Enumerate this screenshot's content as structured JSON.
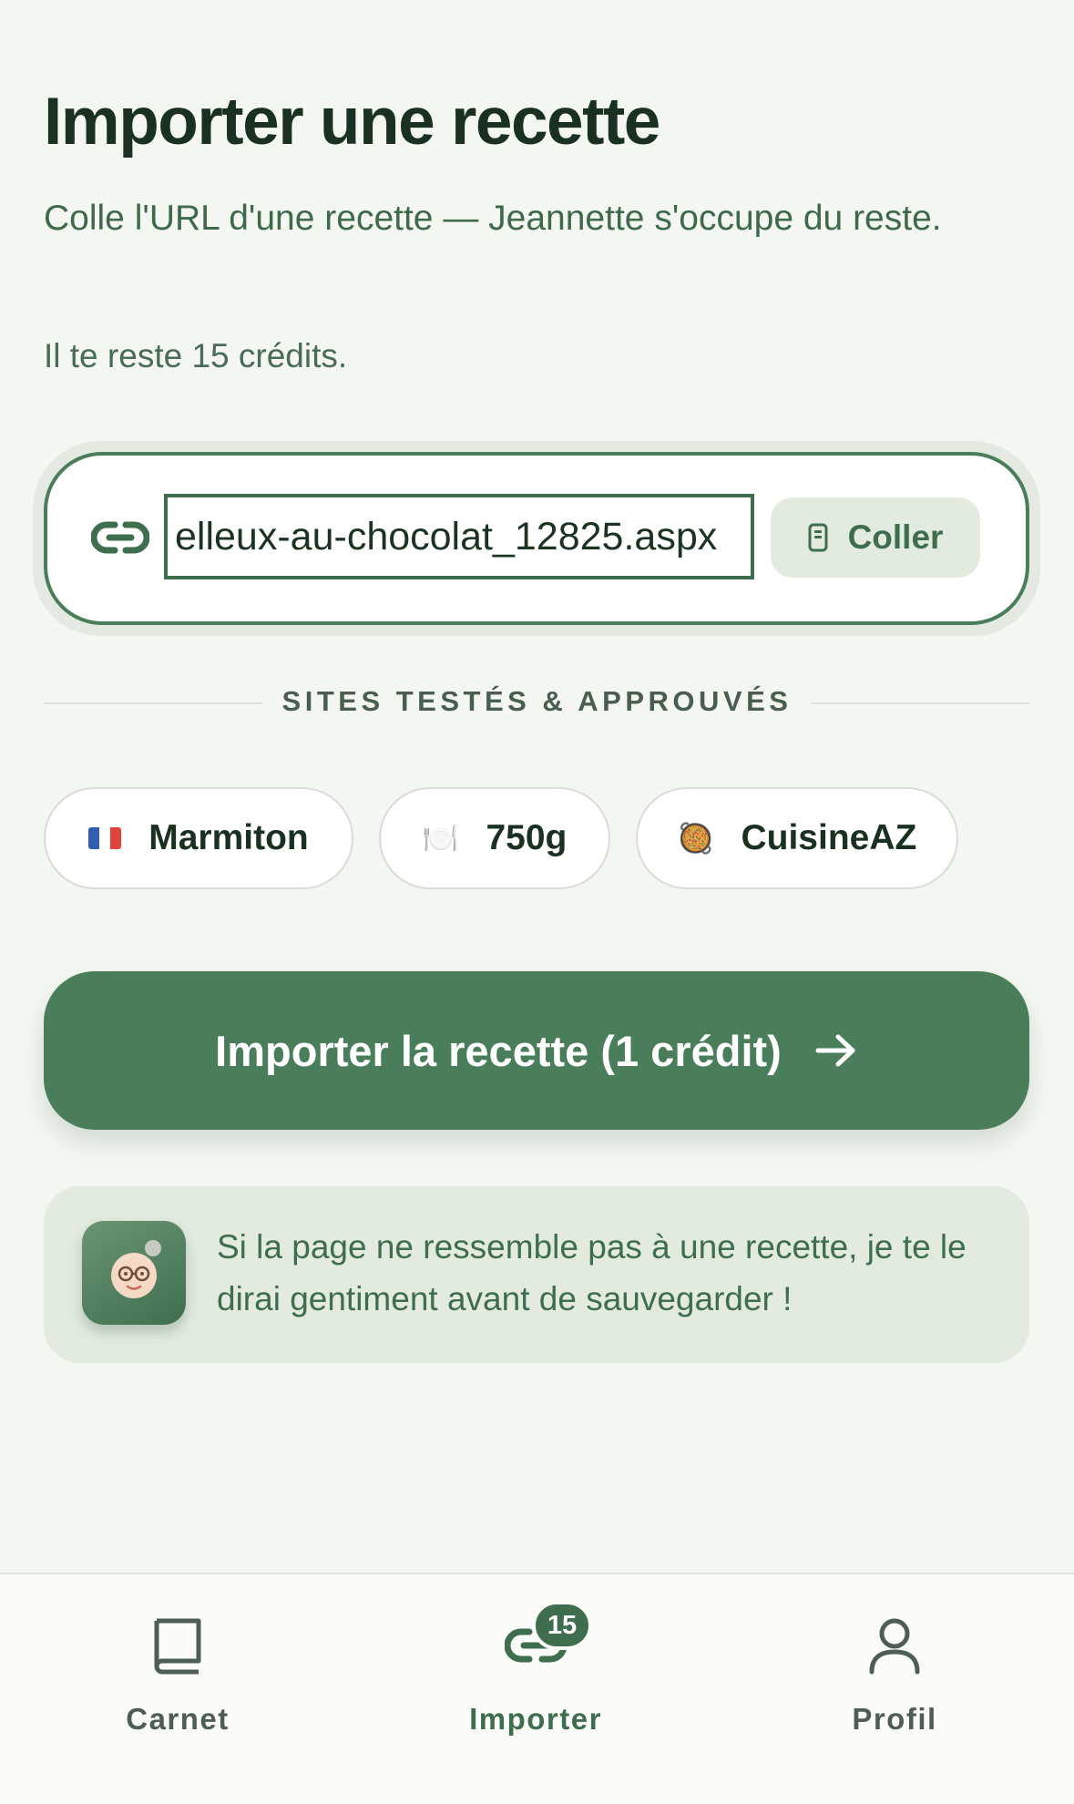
{
  "header": {
    "title": "Importer une recette",
    "subtitle": "Colle l'URL d'une recette — Jeannette s'occupe du reste.",
    "credits_text": "Il te reste 15 crédits."
  },
  "url_field": {
    "icon": "link-icon",
    "value": "elleux-au-chocolat_12825.aspx",
    "paste_icon": "clipboard-icon",
    "paste_label": "Coller"
  },
  "sites": {
    "heading": "SITES TESTÉS & APPROUVÉS",
    "items": [
      {
        "icon": "france-flag-icon",
        "label": "Marmiton"
      },
      {
        "icon": "plate-cutlery-icon",
        "emoji": "🍽️",
        "label": "750g"
      },
      {
        "icon": "paella-icon",
        "emoji": "🥘",
        "label": "CuisineAZ"
      }
    ]
  },
  "import_button": {
    "label": "Importer la recette (1 crédit)",
    "icon": "arrow-right-icon"
  },
  "info": {
    "avatar": "grandma-avatar",
    "text": "Si la page ne ressemble pas à une recette, je te le dirai gentiment avant de sauvegarder !"
  },
  "nav": {
    "items": [
      {
        "label": "Carnet",
        "icon": "book-icon",
        "active": false
      },
      {
        "label": "Importer",
        "icon": "link-icon",
        "active": true,
        "badge": "15"
      },
      {
        "label": "Profil",
        "icon": "person-icon",
        "active": false
      }
    ]
  },
  "colors": {
    "accent": "#4a7d59",
    "accent_dark": "#3f6e4f",
    "background": "#f4f6f2",
    "card": "#e3ebe0",
    "title": "#1a3121"
  }
}
